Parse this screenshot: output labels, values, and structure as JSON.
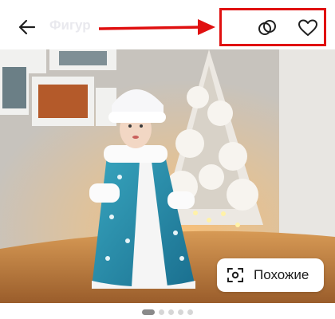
{
  "header": {
    "title": "Фигур",
    "back_icon": "arrow-left-icon",
    "compare_icon": "compare-circles-icon",
    "favorite_icon": "heart-icon"
  },
  "product_image": {
    "alt": ""
  },
  "similar_button": {
    "label": "Похожие",
    "icon": "scan-icon"
  },
  "gallery": {
    "total": 5,
    "active_index": 0
  },
  "annotation": {
    "color": "#e01010"
  }
}
